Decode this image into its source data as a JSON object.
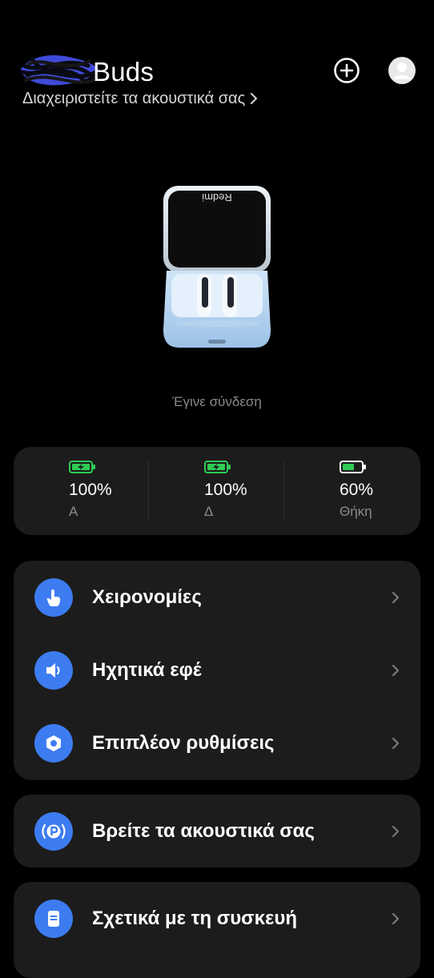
{
  "header": {
    "title": "Buds",
    "subtitle": "Διαχειριστείτε τα ακουστικά σας",
    "add_icon": "plus-circle-icon",
    "avatar_icon": "user-avatar-icon"
  },
  "device": {
    "status": "Έγινε σύνδεση"
  },
  "battery": [
    {
      "percent": "100%",
      "label": "Α",
      "level": 1.0,
      "charging": true
    },
    {
      "percent": "100%",
      "label": "Δ",
      "level": 1.0,
      "charging": true
    },
    {
      "percent": "60%",
      "label": "Θήκη",
      "level": 0.6,
      "charging": false
    }
  ],
  "menu": {
    "gestures": "Χειρονομίες",
    "sound_effects": "Ηχητικά εφέ",
    "more_settings": "Επιπλέον ρυθμίσεις",
    "find_earbuds": "Βρείτε τα ακουστικά σας",
    "about_device": "Σχετικά με τη συσκευή"
  },
  "colors": {
    "accent": "#3d7cf0",
    "card": "#1c1c1c",
    "battery_green": "#2ecc55",
    "background": "#000000"
  }
}
